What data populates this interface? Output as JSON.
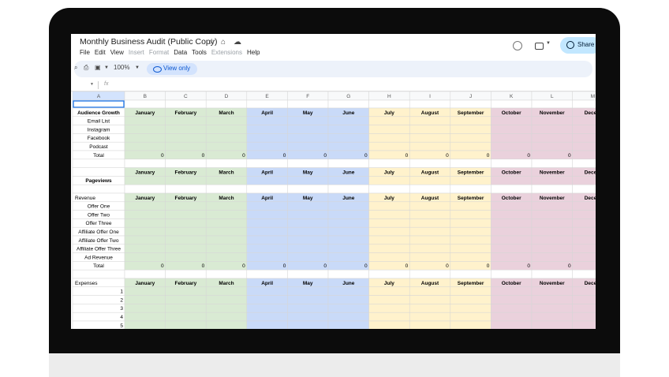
{
  "doc": {
    "title": "Monthly Business Audit (Public Copy)",
    "menu": [
      {
        "label": "File",
        "enabled": true
      },
      {
        "label": "Edit",
        "enabled": true
      },
      {
        "label": "View",
        "enabled": true
      },
      {
        "label": "Insert",
        "enabled": false
      },
      {
        "label": "Format",
        "enabled": false
      },
      {
        "label": "Data",
        "enabled": true
      },
      {
        "label": "Tools",
        "enabled": true
      },
      {
        "label": "Extensions",
        "enabled": false
      },
      {
        "label": "Help",
        "enabled": true
      }
    ],
    "share_label": "Share"
  },
  "toolbar": {
    "zoom": "100%",
    "view_only": "View only"
  },
  "formula_bar": {
    "fx": "fx"
  },
  "colors": {
    "q1": "#d9ead3",
    "q2": "#c9daf8",
    "q3": "#fff2cc",
    "q4": "#ead1dc",
    "white": "#ffffff",
    "gridline": "#d6d6d6",
    "header_bg": "#f8f9fa",
    "selected_header": "#d3e3fd"
  },
  "sheet": {
    "column_headers": [
      "A",
      "B",
      "C",
      "D",
      "E",
      "F",
      "G",
      "H",
      "I",
      "J",
      "K",
      "L",
      "M"
    ],
    "months": [
      "January",
      "February",
      "March",
      "April",
      "May",
      "June",
      "July",
      "August",
      "September",
      "October",
      "November",
      "Decem"
    ],
    "rows": [
      {
        "h": 10,
        "type": "selected"
      },
      {
        "h": 10.8,
        "type": "months",
        "label": "Audience Growth",
        "bold": true,
        "align": "center"
      },
      {
        "h": 10.8,
        "type": "data",
        "label": "Email List",
        "align": "center"
      },
      {
        "h": 10.8,
        "type": "data",
        "label": "Instagram",
        "align": "center"
      },
      {
        "h": 10.8,
        "type": "data",
        "label": "Facebook",
        "align": "center"
      },
      {
        "h": 10.8,
        "type": "data",
        "label": "Podcast",
        "align": "center"
      },
      {
        "h": 10.8,
        "type": "total",
        "label": "Total",
        "align": "center",
        "values": [
          "0",
          "0",
          "0",
          "0",
          "0",
          "0",
          "0",
          "0",
          "0",
          "0",
          "0",
          ""
        ]
      },
      {
        "h": 10.8,
        "type": "empty"
      },
      {
        "h": 10.8,
        "type": "months",
        "label": ""
      },
      {
        "h": 10.8,
        "type": "data",
        "label": "Pageviews",
        "bold": true,
        "align": "center"
      },
      {
        "h": 10.8,
        "type": "empty"
      },
      {
        "h": 10.8,
        "type": "months",
        "label": "Revenue",
        "align": "left"
      },
      {
        "h": 10.8,
        "type": "data",
        "label": "Offer One",
        "align": "center"
      },
      {
        "h": 10.8,
        "type": "data",
        "label": "Offer Two",
        "align": "center"
      },
      {
        "h": 10.8,
        "type": "data",
        "label": "Offer Three",
        "align": "center"
      },
      {
        "h": 10.8,
        "type": "data",
        "label": "Affiliate Offer One",
        "align": "center"
      },
      {
        "h": 10.8,
        "type": "data",
        "label": "Affiliate Offer Two",
        "align": "center"
      },
      {
        "h": 10.8,
        "type": "data",
        "label": "Affiliate Offer Three",
        "align": "center"
      },
      {
        "h": 10.8,
        "type": "data",
        "label": "Ad Revenue",
        "align": "center"
      },
      {
        "h": 10.8,
        "type": "total",
        "label": "Total",
        "align": "center",
        "values": [
          "0",
          "0",
          "0",
          "0",
          "0",
          "0",
          "0",
          "0",
          "0",
          "0",
          "0",
          ""
        ]
      },
      {
        "h": 10.8,
        "type": "empty"
      },
      {
        "h": 10.8,
        "type": "months",
        "label": "Expenses",
        "align": "left"
      },
      {
        "h": 10.8,
        "type": "data",
        "label": "1",
        "align": "right"
      },
      {
        "h": 10.8,
        "type": "data",
        "label": "2",
        "align": "right"
      },
      {
        "h": 10.8,
        "type": "data",
        "label": "3",
        "align": "right"
      },
      {
        "h": 10.8,
        "type": "data",
        "label": "4",
        "align": "right"
      },
      {
        "h": 10.8,
        "type": "data",
        "label": "5",
        "align": "right"
      }
    ]
  }
}
